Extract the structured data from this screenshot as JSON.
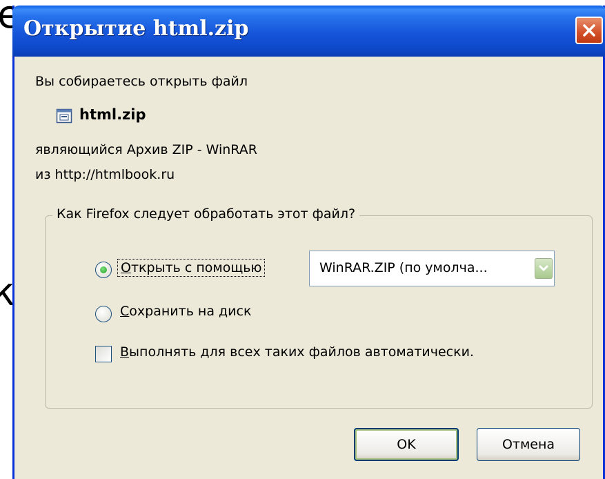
{
  "background": {
    "char_top": "е",
    "char_mid": "к"
  },
  "dialog": {
    "title": "Открытие html.zip",
    "intro": "Вы собираетесь открыть файл",
    "file": {
      "name": "html.zip",
      "icon": "winrar-archive-icon"
    },
    "type_text": "являющийся  Архив ZIP - WinRAR",
    "from_text": "из  http://htmlbook.ru",
    "group": {
      "legend": "Как Firefox следует обработать этот файл?",
      "open_with": {
        "selected": true,
        "accel": "О",
        "label_rest": "ткрыть с помощью",
        "app_value": "WinRAR.ZIP (по умолча..."
      },
      "save_to_disk": {
        "selected": false,
        "accel": "С",
        "label_rest": "охранить на диск"
      },
      "auto": {
        "checked": false,
        "accel": "В",
        "label_rest": "ыполнять для всех таких файлов автоматически."
      }
    },
    "buttons": {
      "ok": "OK",
      "cancel": "Отмена"
    }
  },
  "colors": {
    "titlebar": "#0a5fe8",
    "window_bg": "#ece9d8",
    "close_button": "#d24f28",
    "accent_green": "#21a121"
  }
}
